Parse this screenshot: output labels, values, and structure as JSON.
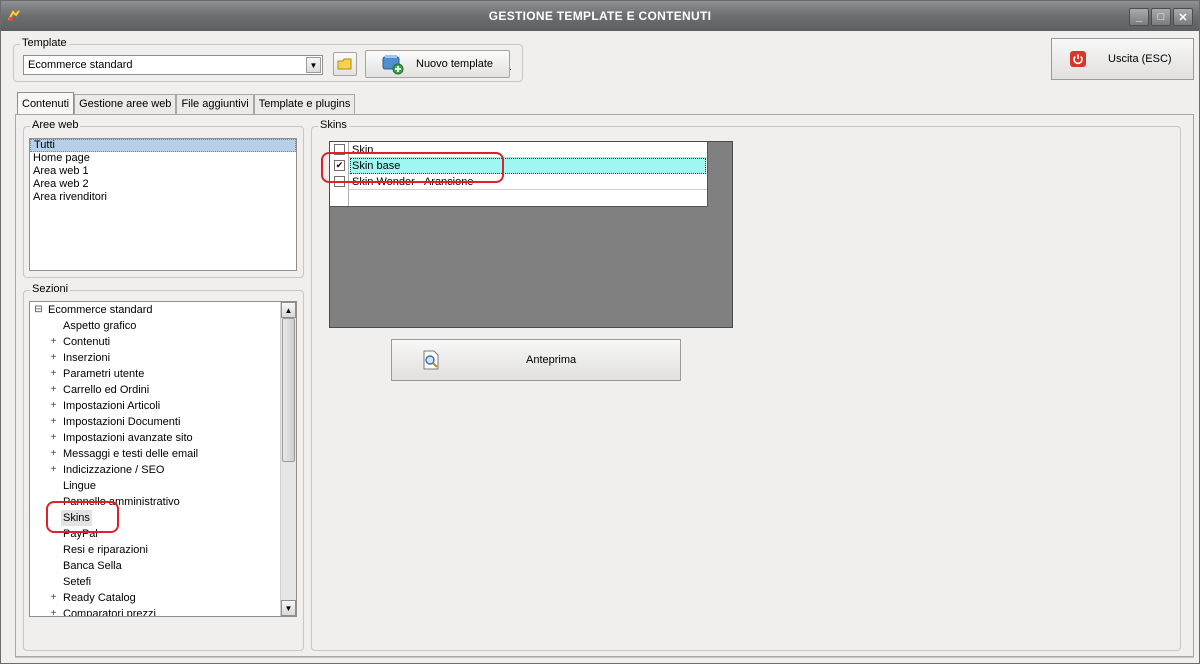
{
  "window": {
    "title": "GESTIONE TEMPLATE E CONTENUTI",
    "controls": [
      "_",
      "□",
      "✕"
    ]
  },
  "template_group": {
    "label": "Template",
    "selected": "Ecommerce standard",
    "new_button": "Nuovo template",
    "extra_char": "."
  },
  "exit_button": {
    "label": "Uscita (ESC)"
  },
  "tabs": [
    {
      "label": "Contenuti",
      "active": true
    },
    {
      "label": "Gestione aree web",
      "active": false
    },
    {
      "label": "File aggiuntivi",
      "active": false
    },
    {
      "label": "Template e plugins",
      "active": false
    }
  ],
  "aree_web": {
    "label": "Aree web",
    "items": [
      "Tutti",
      "Home page",
      "Area web 1",
      "Area web 2",
      "Area rivenditori"
    ],
    "selected_index": 0
  },
  "sezioni": {
    "label": "Sezioni",
    "root": "Ecommerce standard",
    "items": [
      {
        "label": "Aspetto grafico",
        "expandable": false
      },
      {
        "label": "Contenuti",
        "expandable": true
      },
      {
        "label": "Inserzioni",
        "expandable": true
      },
      {
        "label": "Parametri utente",
        "expandable": true
      },
      {
        "label": "Carrello ed Ordini",
        "expandable": true
      },
      {
        "label": "Impostazioni Articoli",
        "expandable": true
      },
      {
        "label": "Impostazioni Documenti",
        "expandable": true
      },
      {
        "label": "Impostazioni avanzate sito",
        "expandable": true
      },
      {
        "label": "Messaggi e testi delle email",
        "expandable": true
      },
      {
        "label": "Indicizzazione / SEO",
        "expandable": true
      },
      {
        "label": "Lingue",
        "expandable": false
      },
      {
        "label": "Pannello amministrativo",
        "expandable": false
      },
      {
        "label": "Skins",
        "expandable": false,
        "selected": true
      },
      {
        "label": "PayPal",
        "expandable": false
      },
      {
        "label": "Resi e riparazioni",
        "expandable": false
      },
      {
        "label": "Banca Sella",
        "expandable": false
      },
      {
        "label": "Setefi",
        "expandable": false
      },
      {
        "label": "Ready Catalog",
        "expandable": true
      },
      {
        "label": "Comparatori prezzi",
        "expandable": true
      }
    ]
  },
  "skins": {
    "label": "Skins",
    "rows": [
      {
        "label": "Skin",
        "checked": false
      },
      {
        "label": "Skin base",
        "checked": true,
        "selected": true
      },
      {
        "label": "Skin Wonder - Arancione",
        "checked": false
      }
    ],
    "preview_button": "Anteprima"
  },
  "colors": {
    "selection_cyan": "#9ff7f2",
    "annotation_red": "#e0202b",
    "exit_icon_red": "#d9352b"
  }
}
